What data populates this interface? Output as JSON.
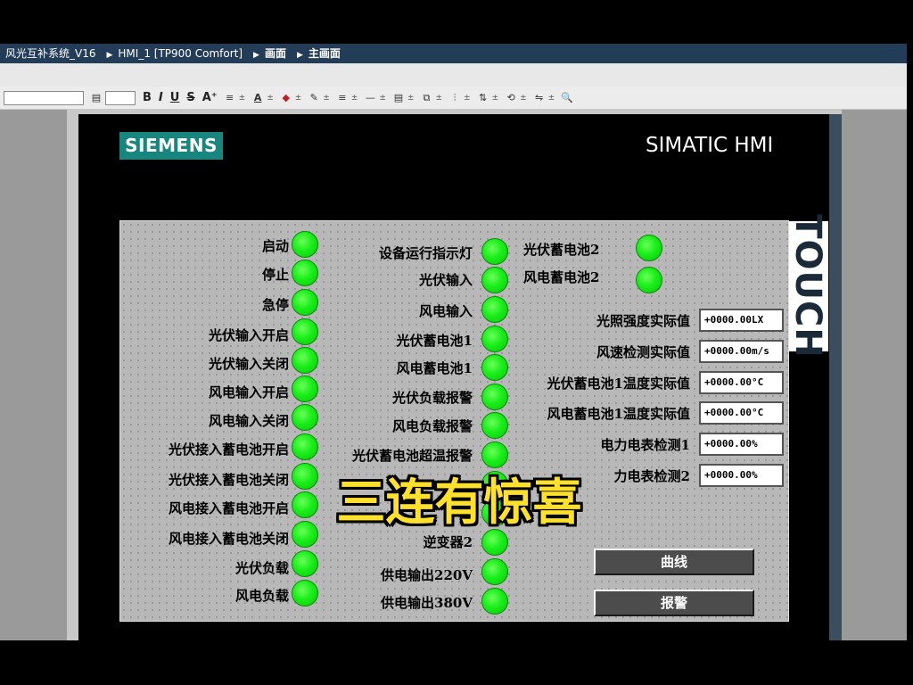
{
  "breadcrumb": [
    "风光互补系统_V16",
    "HMI_1 [TP900 Comfort]",
    "画面",
    "主画面"
  ],
  "toolbar": {
    "bold": "B",
    "italic": "I",
    "underline": "U",
    "strike": "S",
    "font_size_up": "A⁺",
    "align": "≡",
    "font_color": "A",
    "fill": "◆",
    "pen": "✎",
    "line": "—",
    "layers": "▤",
    "group": "⧉",
    "distribute": "⫶",
    "order": "⇅",
    "rotate": "⟲",
    "flip": "⇋",
    "zoom": "🔍"
  },
  "device": {
    "brand": "SIEMENS",
    "model": "SIMATIC HMI",
    "touch": "TOUCH"
  },
  "hmi": {
    "col1": [
      "启动",
      "停止",
      "急停",
      "光伏输入开启",
      "光伏输入关闭",
      "风电输入开启",
      "风电输入关闭",
      "光伏接入蓄电池开启",
      "光伏接入蓄电池关闭",
      "风电接入蓄电池开启",
      "风电接入蓄电池关闭",
      "光伏负载",
      "风电负载"
    ],
    "col2": [
      "设备运行指示灯",
      "光伏输入",
      "风电输入",
      "光伏蓄电池1",
      "风电蓄电池1",
      "光伏负载报警",
      "风电负载报警",
      "光伏蓄电池超温报警",
      "逆变器2",
      "供电输出220V",
      "供电输出380V"
    ],
    "col3": [
      "光伏蓄电池2",
      "风电蓄电池2"
    ],
    "measure_labels": [
      "光照强度实际值",
      "风速检测实际值",
      "光伏蓄电池1温度实际值",
      "风电蓄电池1温度实际值",
      "电力电表检测1",
      "力电表检测2"
    ],
    "measure_values": [
      "+0000.00LX",
      "+0000.00m/s",
      "+0000.00°C",
      "+0000.00°C",
      "+0000.00%",
      "+0000.00%"
    ],
    "buttons": {
      "curve": "曲线",
      "alarm": "报警"
    }
  },
  "overlay_text": "三连有惊喜",
  "colors": {
    "led": "#19ee19",
    "crumb_bg": "#233d58",
    "logo": "#17867e",
    "overlay": "#ffe02a"
  }
}
